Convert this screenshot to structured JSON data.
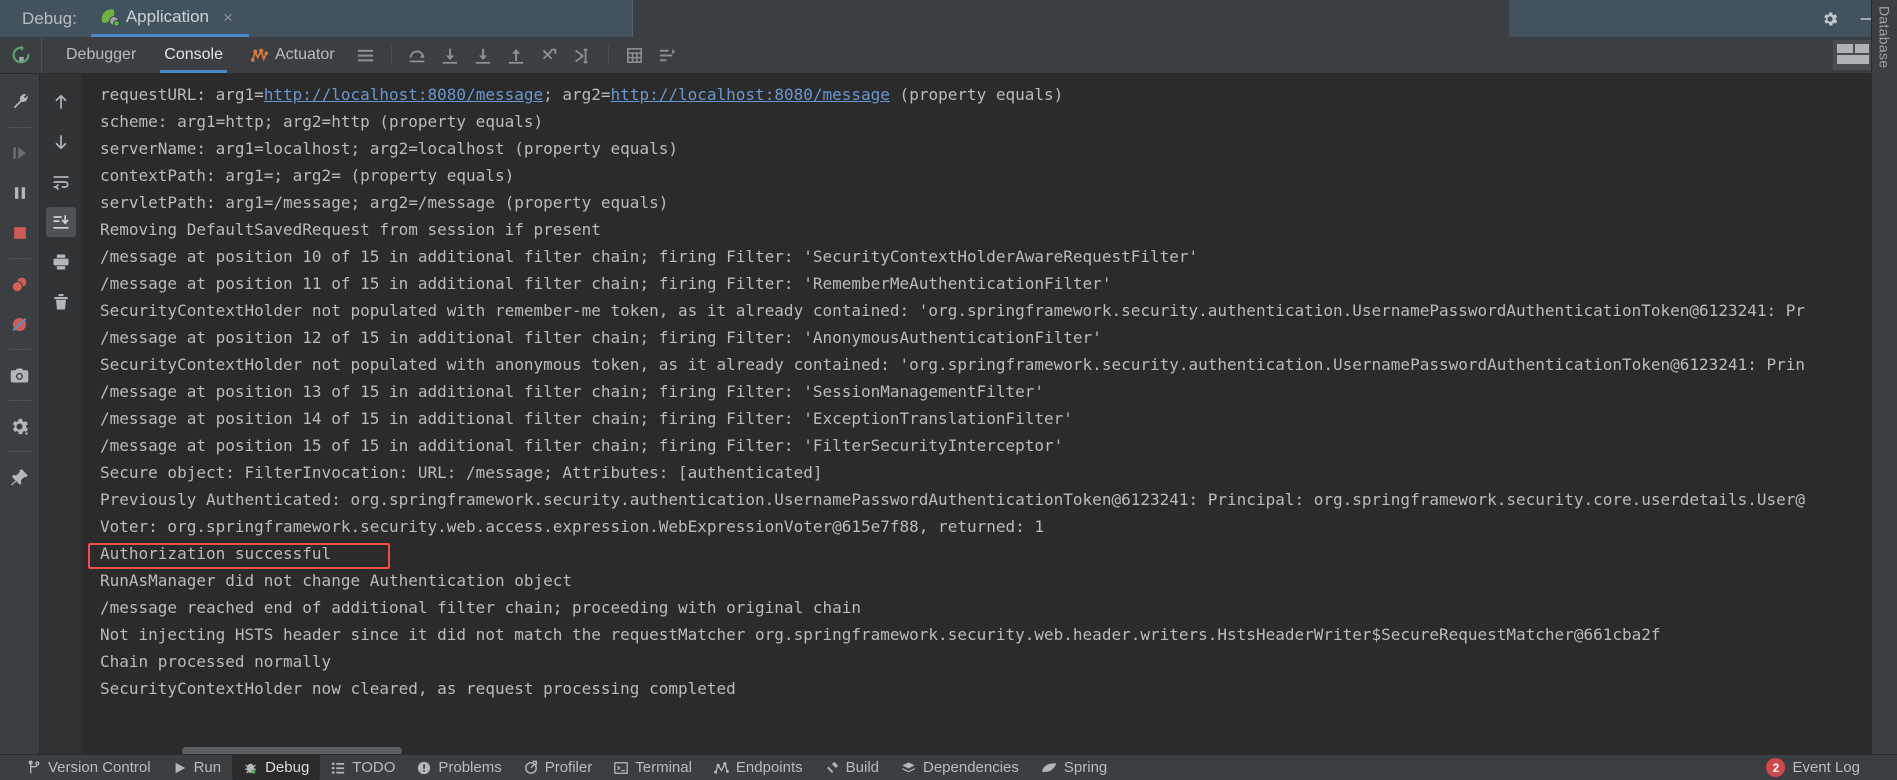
{
  "titlebar": {
    "debug_label": "Debug:",
    "run_tab": {
      "title": "Application",
      "icon": "spring-boot-icon",
      "close": "×"
    },
    "settings_icon": "gear-icon",
    "minimize_icon": "minimize-icon"
  },
  "subbar": {
    "rerun_icon": "rerun-icon",
    "tabs": [
      {
        "label": "Debugger",
        "active": false
      },
      {
        "label": "Console",
        "active": true
      },
      {
        "label": "Actuator",
        "active": false,
        "icon": "actuator-icon"
      }
    ],
    "icons": [
      "layout-settings-icon",
      "step-over-icon",
      "step-into-icon",
      "force-step-into-icon",
      "step-out-icon",
      "drop-frame-icon",
      "run-to-cursor-icon",
      "evaluate-expression-icon",
      "threads-view-icon"
    ],
    "right_icon": "restore-layout-icon"
  },
  "left_toolbar": {
    "icons": [
      "wrench-icon",
      "resume-program-icon",
      "pause-program-icon",
      "stop-icon",
      "view-breakpoints-icon",
      "mute-breakpoints-icon",
      "camera-icon",
      "settings-gear-icon",
      "pin-icon"
    ]
  },
  "console_toolbar": {
    "icons": [
      "scroll-up-icon",
      "scroll-down-icon",
      "soft-wrap-icon",
      "scroll-to-end-icon",
      "print-icon",
      "trash-icon"
    ],
    "selected": "scroll-to-end-icon"
  },
  "console": {
    "lines": [
      {
        "segments": [
          {
            "t": "requestURL: arg1=",
            "link": false
          },
          {
            "t": "http://localhost:8080/message",
            "link": true
          },
          {
            "t": "; arg2=",
            "link": false
          },
          {
            "t": "http://localhost:8080/message",
            "link": true
          },
          {
            "t": " (property equals)",
            "link": false
          }
        ]
      },
      {
        "segments": [
          {
            "t": "scheme: arg1=http; arg2=http (property equals)",
            "link": false
          }
        ]
      },
      {
        "segments": [
          {
            "t": "serverName: arg1=localhost; arg2=localhost (property equals)",
            "link": false
          }
        ]
      },
      {
        "segments": [
          {
            "t": "contextPath: arg1=; arg2= (property equals)",
            "link": false
          }
        ]
      },
      {
        "segments": [
          {
            "t": "servletPath: arg1=/message; arg2=/message (property equals)",
            "link": false
          }
        ]
      },
      {
        "segments": [
          {
            "t": "Removing DefaultSavedRequest from session if present",
            "link": false
          }
        ]
      },
      {
        "segments": [
          {
            "t": "/message at position 10 of 15 in additional filter chain; firing Filter: 'SecurityContextHolderAwareRequestFilter'",
            "link": false
          }
        ]
      },
      {
        "segments": [
          {
            "t": "/message at position 11 of 15 in additional filter chain; firing Filter: 'RememberMeAuthenticationFilter'",
            "link": false
          }
        ]
      },
      {
        "segments": [
          {
            "t": "SecurityContextHolder not populated with remember-me token, as it already contained: 'org.springframework.security.authentication.UsernamePasswordAuthenticationToken@6123241: Pr",
            "link": false
          }
        ]
      },
      {
        "segments": [
          {
            "t": "/message at position 12 of 15 in additional filter chain; firing Filter: 'AnonymousAuthenticationFilter'",
            "link": false
          }
        ]
      },
      {
        "segments": [
          {
            "t": "SecurityContextHolder not populated with anonymous token, as it already contained: 'org.springframework.security.authentication.UsernamePasswordAuthenticationToken@6123241: Prin",
            "link": false
          }
        ]
      },
      {
        "segments": [
          {
            "t": "/message at position 13 of 15 in additional filter chain; firing Filter: 'SessionManagementFilter'",
            "link": false
          }
        ]
      },
      {
        "segments": [
          {
            "t": "/message at position 14 of 15 in additional filter chain; firing Filter: 'ExceptionTranslationFilter'",
            "link": false
          }
        ]
      },
      {
        "segments": [
          {
            "t": "/message at position 15 of 15 in additional filter chain; firing Filter: 'FilterSecurityInterceptor'",
            "link": false
          }
        ]
      },
      {
        "segments": [
          {
            "t": "Secure object: FilterInvocation: URL: /message; Attributes: [authenticated]",
            "link": false
          }
        ]
      },
      {
        "segments": [
          {
            "t": "Previously Authenticated: org.springframework.security.authentication.UsernamePasswordAuthenticationToken@6123241: Principal: org.springframework.security.core.userdetails.User@",
            "link": false
          }
        ]
      },
      {
        "segments": [
          {
            "t": "Voter: org.springframework.security.web.access.expression.WebExpressionVoter@615e7f88, returned: 1",
            "link": false
          }
        ]
      },
      {
        "segments": [
          {
            "t": "Authorization successful",
            "link": false
          }
        ],
        "highlighted": true
      },
      {
        "segments": [
          {
            "t": "RunAsManager did not change Authentication object",
            "link": false
          }
        ]
      },
      {
        "segments": [
          {
            "t": "/message reached end of additional filter chain; proceeding with original chain",
            "link": false
          }
        ]
      },
      {
        "segments": [
          {
            "t": "Not injecting HSTS header since it did not match the requestMatcher org.springframework.security.web.header.writers.HstsHeaderWriter$SecureRequestMatcher@661cba2f",
            "link": false
          }
        ]
      },
      {
        "segments": [
          {
            "t": "Chain processed normally",
            "link": false
          }
        ]
      },
      {
        "segments": [
          {
            "t": "SecurityContextHolder now cleared, as request processing completed",
            "link": false
          }
        ]
      }
    ],
    "highlight_color": "#f24b4b"
  },
  "right_strip": {
    "label": "Database"
  },
  "statusbar": {
    "items": [
      {
        "label": "Version Control",
        "icon": "branch-icon",
        "active": false
      },
      {
        "label": "Run",
        "icon": "run-icon",
        "active": false
      },
      {
        "label": "Debug",
        "icon": "debug-bug-icon",
        "active": true
      },
      {
        "label": "TODO",
        "icon": "todo-list-icon",
        "active": false
      },
      {
        "label": "Problems",
        "icon": "problems-icon",
        "active": false
      },
      {
        "label": "Profiler",
        "icon": "profiler-icon",
        "active": false
      },
      {
        "label": "Terminal",
        "icon": "terminal-icon",
        "active": false
      },
      {
        "label": "Endpoints",
        "icon": "endpoints-icon",
        "active": false
      },
      {
        "label": "Build",
        "icon": "build-hammer-icon",
        "active": false
      },
      {
        "label": "Dependencies",
        "icon": "dependencies-icon",
        "active": false
      },
      {
        "label": "Spring",
        "icon": "spring-leaf-icon",
        "active": false
      }
    ],
    "event_log": {
      "label": "Event Log",
      "count": "2",
      "badge_color": "#d0474b"
    }
  }
}
